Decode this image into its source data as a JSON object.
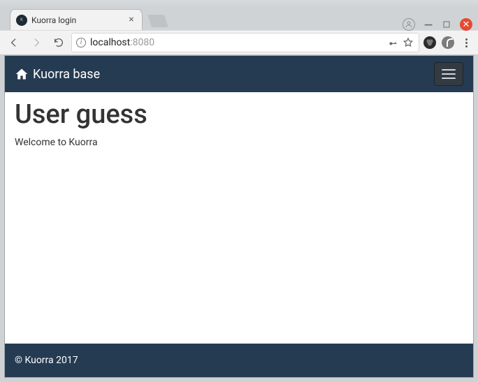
{
  "browser": {
    "tab": {
      "title": "Kuorra login",
      "favicon_label": "Kuorra"
    },
    "url": {
      "host": "localhost",
      "port": ":8080"
    }
  },
  "page": {
    "navbar": {
      "brand": "Kuorra base"
    },
    "heading": "User guess",
    "welcome": "Welcome to Kuorra",
    "footer": "© Kuorra 2017"
  }
}
